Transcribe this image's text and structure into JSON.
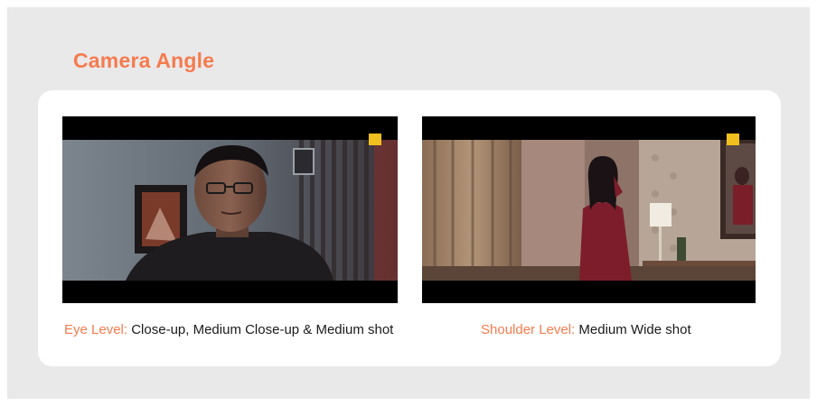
{
  "slide": {
    "title": "Camera Angle"
  },
  "shots": [
    {
      "level_label": "Eye Level:",
      "description": "Close-up, Medium Close-up & Medium shot"
    },
    {
      "level_label": "Shoulder Level:",
      "description": "Medium Wide shot"
    }
  ],
  "colors": {
    "accent": "#f57b4e",
    "background": "#e9e9ea",
    "card": "#ffffff",
    "logo_badge": "#f2c01e"
  }
}
